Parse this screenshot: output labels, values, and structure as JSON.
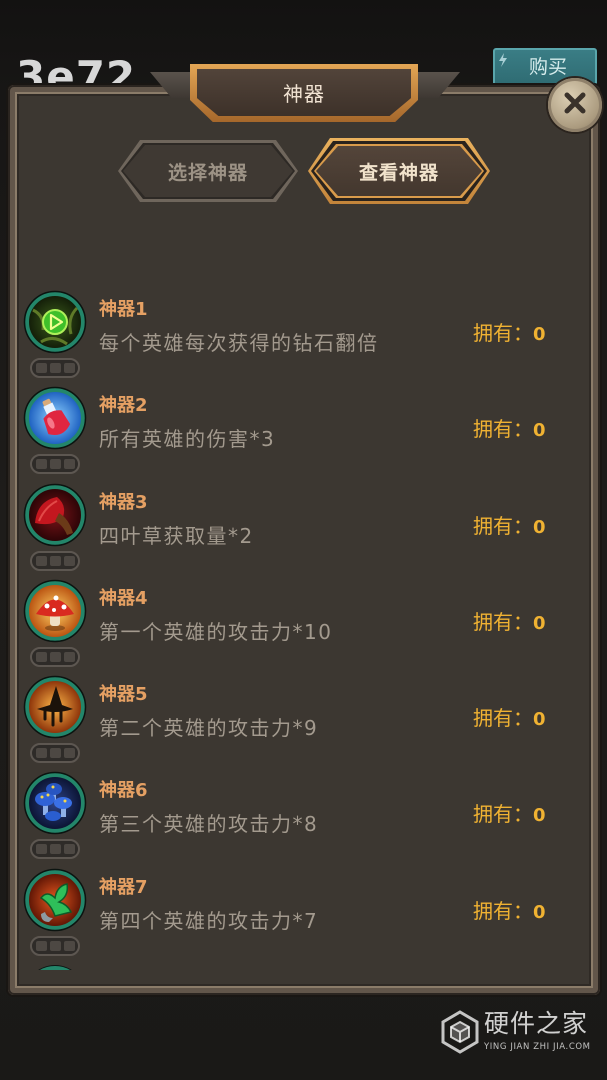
{
  "background": {
    "counter": "3e72"
  },
  "buy_button": {
    "label": "购买",
    "icon": "lightning-icon"
  },
  "panel": {
    "title": "神器",
    "close_icon": "close-icon"
  },
  "tabs": [
    {
      "label": "选择神器",
      "active": false
    },
    {
      "label": "查看神器",
      "active": true
    }
  ],
  "owned_label": "拥有：",
  "artifacts": [
    {
      "name": "神器1",
      "description": "每个英雄每次获得的钻石翻倍",
      "owned": "0",
      "icon": "play-gem-icon"
    },
    {
      "name": "神器2",
      "description": "所有英雄的伤害*3",
      "owned": "0",
      "icon": "potion-icon"
    },
    {
      "name": "神器3",
      "description": "四叶草获取量*2",
      "owned": "0",
      "icon": "red-horn-icon"
    },
    {
      "name": "神器4",
      "description": "第一个英雄的攻击力*10",
      "owned": "0",
      "icon": "mushroom-icon"
    },
    {
      "name": "神器5",
      "description": "第二个英雄的攻击力*9",
      "owned": "0",
      "icon": "witch-hat-icon"
    },
    {
      "name": "神器6",
      "description": "第三个英雄的攻击力*8",
      "owned": "0",
      "icon": "blue-mushrooms-icon"
    },
    {
      "name": "神器7",
      "description": "第四个英雄的攻击力*7",
      "owned": "0",
      "icon": "plant-icon"
    }
  ],
  "watermark": {
    "brand": "硬件之家",
    "site": "YING JIAN ZHI JIA.COM",
    "logo": "hexagon-cube-logo"
  },
  "colors": {
    "artifact_name": "#e5a063",
    "description": "#a39a8e",
    "owned": "#f0b232",
    "buy_button": "#2f6c73",
    "active_tab_border": "#d99b4b",
    "icon_ring": "#23866a"
  }
}
